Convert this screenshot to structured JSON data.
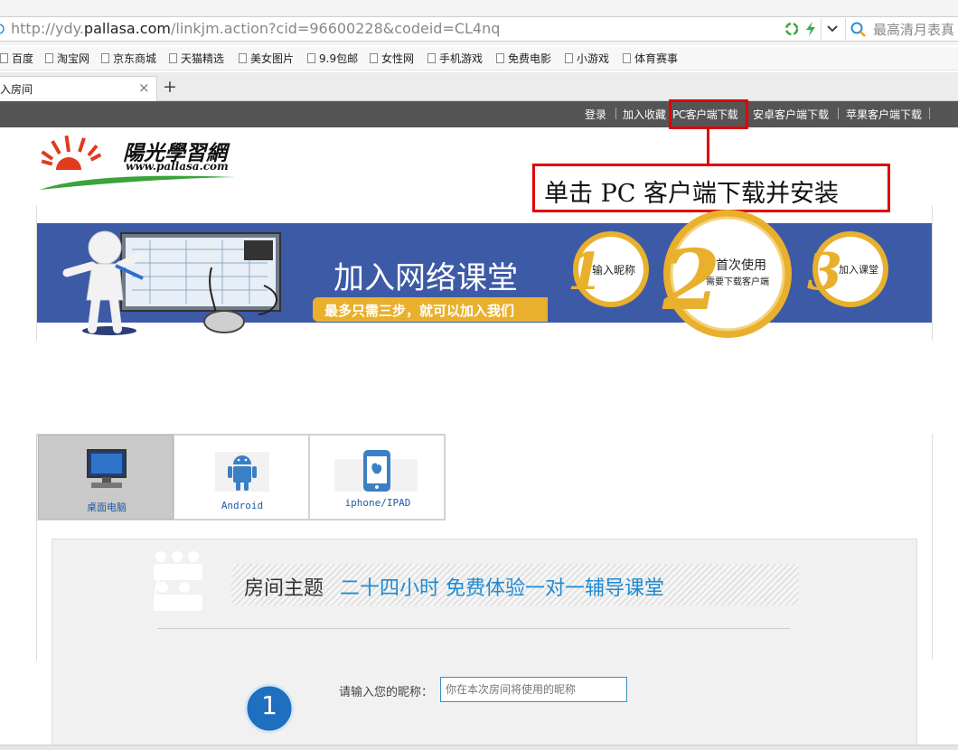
{
  "browser": {
    "url_prefix": "http://ydy.",
    "url_domain": "pallasa.com",
    "url_path": "/linkjm.action?cid=96600228&codeid=CL4nq",
    "search_placeholder": "最高清月表真",
    "bookmarks": [
      "百度",
      "淘宝网",
      "京东商城",
      "天猫精选",
      "美女图片",
      "9.9包邮",
      "女性网",
      "手机游戏",
      "免费电影",
      "小游戏",
      "体育赛事"
    ],
    "tab_title": "入房间",
    "new_tab": "+",
    "close": "×"
  },
  "topnav": {
    "login": "登录",
    "favorite": "加入收藏",
    "pc_download": "PC客户端下载",
    "android_download": "安卓客户端下载",
    "apple_download": "苹果客户端下载"
  },
  "logo": {
    "name": "陽光學習網",
    "domain": "www.pallasa.com"
  },
  "annotation": {
    "text": "单击 PC 客户端下载并安装"
  },
  "banner": {
    "title": "加入网络课堂",
    "subtitle": "最多只需三步，就可以加入我们",
    "steps": [
      {
        "num": "1",
        "label": "输入昵称"
      },
      {
        "num": "2",
        "label": "首次使用",
        "sublabel": "需要下载客户端"
      },
      {
        "num": "3",
        "label": "加入课堂"
      }
    ]
  },
  "devices": [
    {
      "label": "桌面电脑",
      "active": true
    },
    {
      "label": "Android",
      "active": false
    },
    {
      "label": "iphone/IPAD",
      "active": false
    }
  ],
  "room": {
    "topic_label": "房间主题",
    "topic_value": "二十四小时 免费体验一对一辅导课堂",
    "step_number": "1",
    "nickname_label": "请输入您的昵称：",
    "nickname_placeholder": "你在本次房间将使用的昵称"
  },
  "colors": {
    "banner_blue": "#3d5aa6",
    "gold": "#e8b02c",
    "annotation_red": "#e00000",
    "topic_blue": "#1e8bd3",
    "topbar_grey": "#555555"
  }
}
